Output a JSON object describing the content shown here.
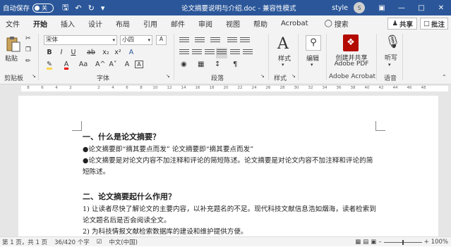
{
  "titlebar": {
    "autosave_label": "自动保存",
    "autosave_state": "关",
    "doc_title": "论文摘要说明与介绍.doc - 兼容性模式",
    "style_label": "style",
    "user_initial": "S"
  },
  "menu": {
    "items": [
      "文件",
      "开始",
      "插入",
      "设计",
      "布局",
      "引用",
      "邮件",
      "审阅",
      "视图",
      "帮助",
      "Acrobat"
    ],
    "search": "搜索",
    "share": "共享",
    "comment": "批注"
  },
  "ribbon": {
    "paste": "粘贴",
    "clipboard": "剪贴板",
    "font_name": "宋体",
    "font_size": "小四",
    "font_group": "字体",
    "paragraph_group": "段落",
    "styles": "样式",
    "styles_group": "样式",
    "editing": "编辑",
    "acrobat_btn_line1": "创建并共享",
    "acrobat_btn_line2": "Adobe PDF",
    "acrobat_group": "Adobe Acrobat",
    "dictate": "听写",
    "voice_group": "语音",
    "font_buttons": [
      "B",
      "I",
      "U",
      "ab",
      "x₂",
      "x²",
      "A"
    ],
    "font_buttons2": [
      "A",
      "Aa",
      "A",
      "A"
    ],
    "size_buttons": [
      "A^",
      "A˅"
    ]
  },
  "ruler": {
    "ticks": [
      "8",
      "6",
      "4",
      "2",
      "",
      "2",
      "4",
      "6",
      "8",
      "10",
      "12",
      "14",
      "16",
      "18",
      "20",
      "22",
      "24",
      "26",
      "28",
      "30",
      "32",
      "34",
      "36",
      "38",
      "40",
      "42",
      "44",
      "46",
      "48"
    ]
  },
  "document": {
    "h1": "一、什么是论文摘要？",
    "p1": "●论文摘要即“摘其要点而发” 论文摘要即“摘其要点而发”",
    "p2": "●论文摘要是对论文内容不加注释和评论的简短陈述。论文摘要是对论文内容不加注释和评论的简短陈述。",
    "h2": "二、论文摘要起什么作用？",
    "p3": "1) 让读者尽快了解论文的主要内容，以补充题名的不足。现代科技文献信息浩如烟海，读者检索到论文题名后是否会阅读全文。",
    "p4": "2) 为科技情报文献检索数据库的建设和维护提供方便。"
  },
  "status": {
    "page": "第 1 页，共 1 页",
    "words": "36/420 个字",
    "lang": "中文(中国)",
    "zoom": "100%"
  },
  "colors": {
    "titlebar": "#2b579a",
    "highlight": "#ffd54a",
    "font_color": "#e00000",
    "acrobat_red": "#b30b00"
  }
}
